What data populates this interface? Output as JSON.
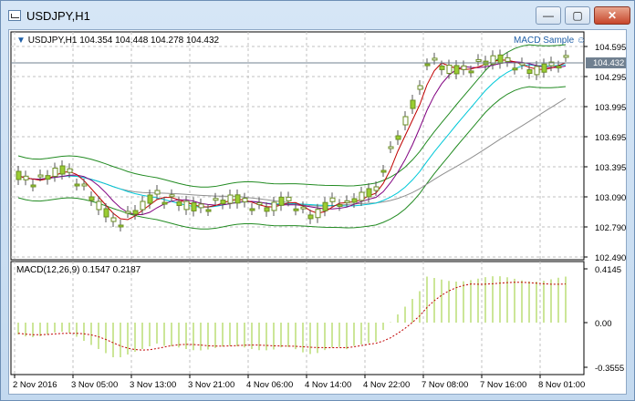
{
  "window": {
    "title": "USDJPY,H1",
    "minimize": "—",
    "maximize": "▢",
    "close": "✕"
  },
  "chart": {
    "info": "USDJPY,H1  104.354 104.448 104.278 104.432",
    "expert": "MACD Sample",
    "current_price": "104.432",
    "price_ticks": [
      "104.595",
      "104.295",
      "103.995",
      "103.695",
      "103.395",
      "103.090",
      "102.790",
      "102.490"
    ],
    "time_ticks": [
      "2 Nov 2016",
      "3 Nov 05:00",
      "3 Nov 13:00",
      "3 Nov 21:00",
      "4 Nov 06:00",
      "4 Nov 14:00",
      "4 Nov 22:00",
      "7 Nov 08:00",
      "7 Nov 16:00",
      "8 Nov 01:00"
    ]
  },
  "macd": {
    "label": "MACD(12,26,9)  0.1547 0.2187",
    "ticks": [
      "0.4145",
      "0.00",
      "-0.3555"
    ]
  },
  "colors": {
    "bull": "#9acd32",
    "bear": "#9acd32",
    "grid": "#c0c0c0",
    "bands": "#228b22",
    "fast_ma": "#c00000",
    "mid_ma": "#800080",
    "slow_ma": "#00c8d8",
    "long_ma": "#909090",
    "signal": "#c00000"
  }
}
